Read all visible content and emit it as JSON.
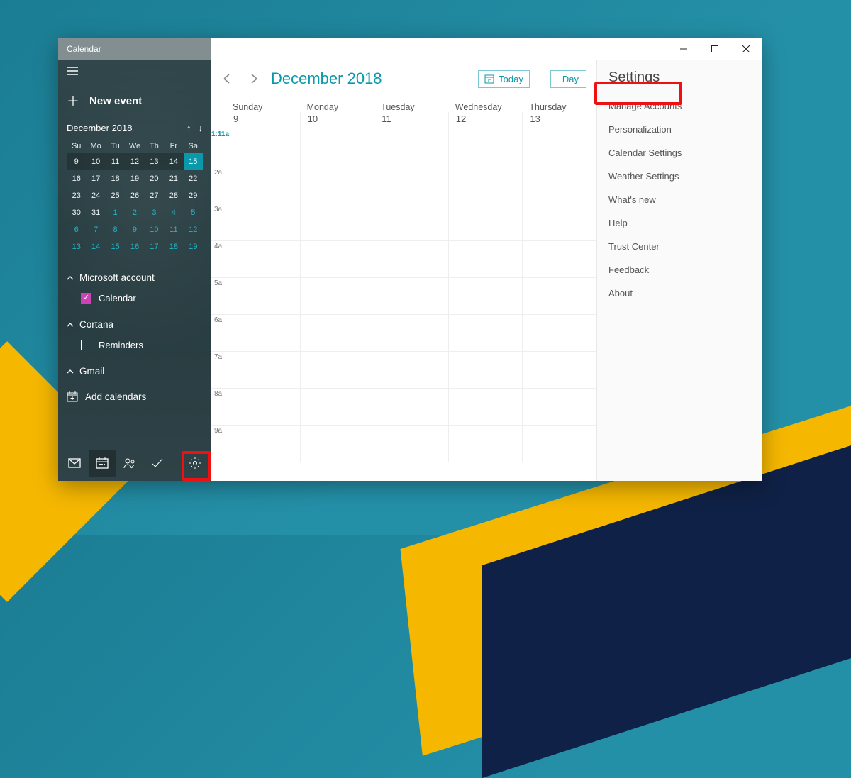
{
  "window": {
    "title": "Calendar"
  },
  "sidebar": {
    "newEvent": "New event",
    "monthLabel": "December 2018",
    "dow": [
      "Su",
      "Mo",
      "Tu",
      "We",
      "Th",
      "Fr",
      "Sa"
    ],
    "weeks": [
      [
        {
          "n": "9",
          "cw": true
        },
        {
          "n": "10",
          "cw": true
        },
        {
          "n": "11",
          "cw": true
        },
        {
          "n": "12",
          "cw": true
        },
        {
          "n": "13",
          "cw": true
        },
        {
          "n": "14",
          "cw": true
        },
        {
          "n": "15",
          "cw": true,
          "today": true
        }
      ],
      [
        {
          "n": "16"
        },
        {
          "n": "17"
        },
        {
          "n": "18"
        },
        {
          "n": "19"
        },
        {
          "n": "20"
        },
        {
          "n": "21"
        },
        {
          "n": "22"
        }
      ],
      [
        {
          "n": "23"
        },
        {
          "n": "24"
        },
        {
          "n": "25"
        },
        {
          "n": "26"
        },
        {
          "n": "27"
        },
        {
          "n": "28"
        },
        {
          "n": "29"
        }
      ],
      [
        {
          "n": "30"
        },
        {
          "n": "31"
        },
        {
          "n": "1",
          "next": true
        },
        {
          "n": "2",
          "next": true
        },
        {
          "n": "3",
          "next": true
        },
        {
          "n": "4",
          "next": true
        },
        {
          "n": "5",
          "next": true
        }
      ],
      [
        {
          "n": "6",
          "next": true
        },
        {
          "n": "7",
          "next": true
        },
        {
          "n": "8",
          "next": true
        },
        {
          "n": "9",
          "next": true
        },
        {
          "n": "10",
          "next": true
        },
        {
          "n": "11",
          "next": true
        },
        {
          "n": "12",
          "next": true
        }
      ],
      [
        {
          "n": "13",
          "next": true
        },
        {
          "n": "14",
          "next": true
        },
        {
          "n": "15",
          "next": true
        },
        {
          "n": "16",
          "next": true
        },
        {
          "n": "17",
          "next": true
        },
        {
          "n": "18",
          "next": true
        },
        {
          "n": "19",
          "next": true
        }
      ]
    ],
    "accounts": [
      {
        "name": "Microsoft account",
        "items": [
          {
            "label": "Calendar",
            "checked": true
          }
        ]
      },
      {
        "name": "Cortana",
        "items": [
          {
            "label": "Reminders",
            "checked": false
          }
        ]
      },
      {
        "name": "Gmail",
        "items": []
      }
    ],
    "addCalendars": "Add calendars"
  },
  "calendar": {
    "title": "December 2018",
    "todayLabel": "Today",
    "viewLabel": "Day",
    "dayNames": [
      "Sunday",
      "Monday",
      "Tuesday",
      "Wednesday",
      "Thursday"
    ],
    "dayNumbers": [
      "9",
      "10",
      "11",
      "12",
      "13"
    ],
    "nowLabel": "1:11a",
    "hours": [
      "2a",
      "3a",
      "4a",
      "5a",
      "6a",
      "7a",
      "8a",
      "9a"
    ]
  },
  "settings": {
    "title": "Settings",
    "items": [
      "Manage Accounts",
      "Personalization",
      "Calendar Settings",
      "Weather Settings",
      "What's new",
      "Help",
      "Trust Center",
      "Feedback",
      "About"
    ]
  }
}
